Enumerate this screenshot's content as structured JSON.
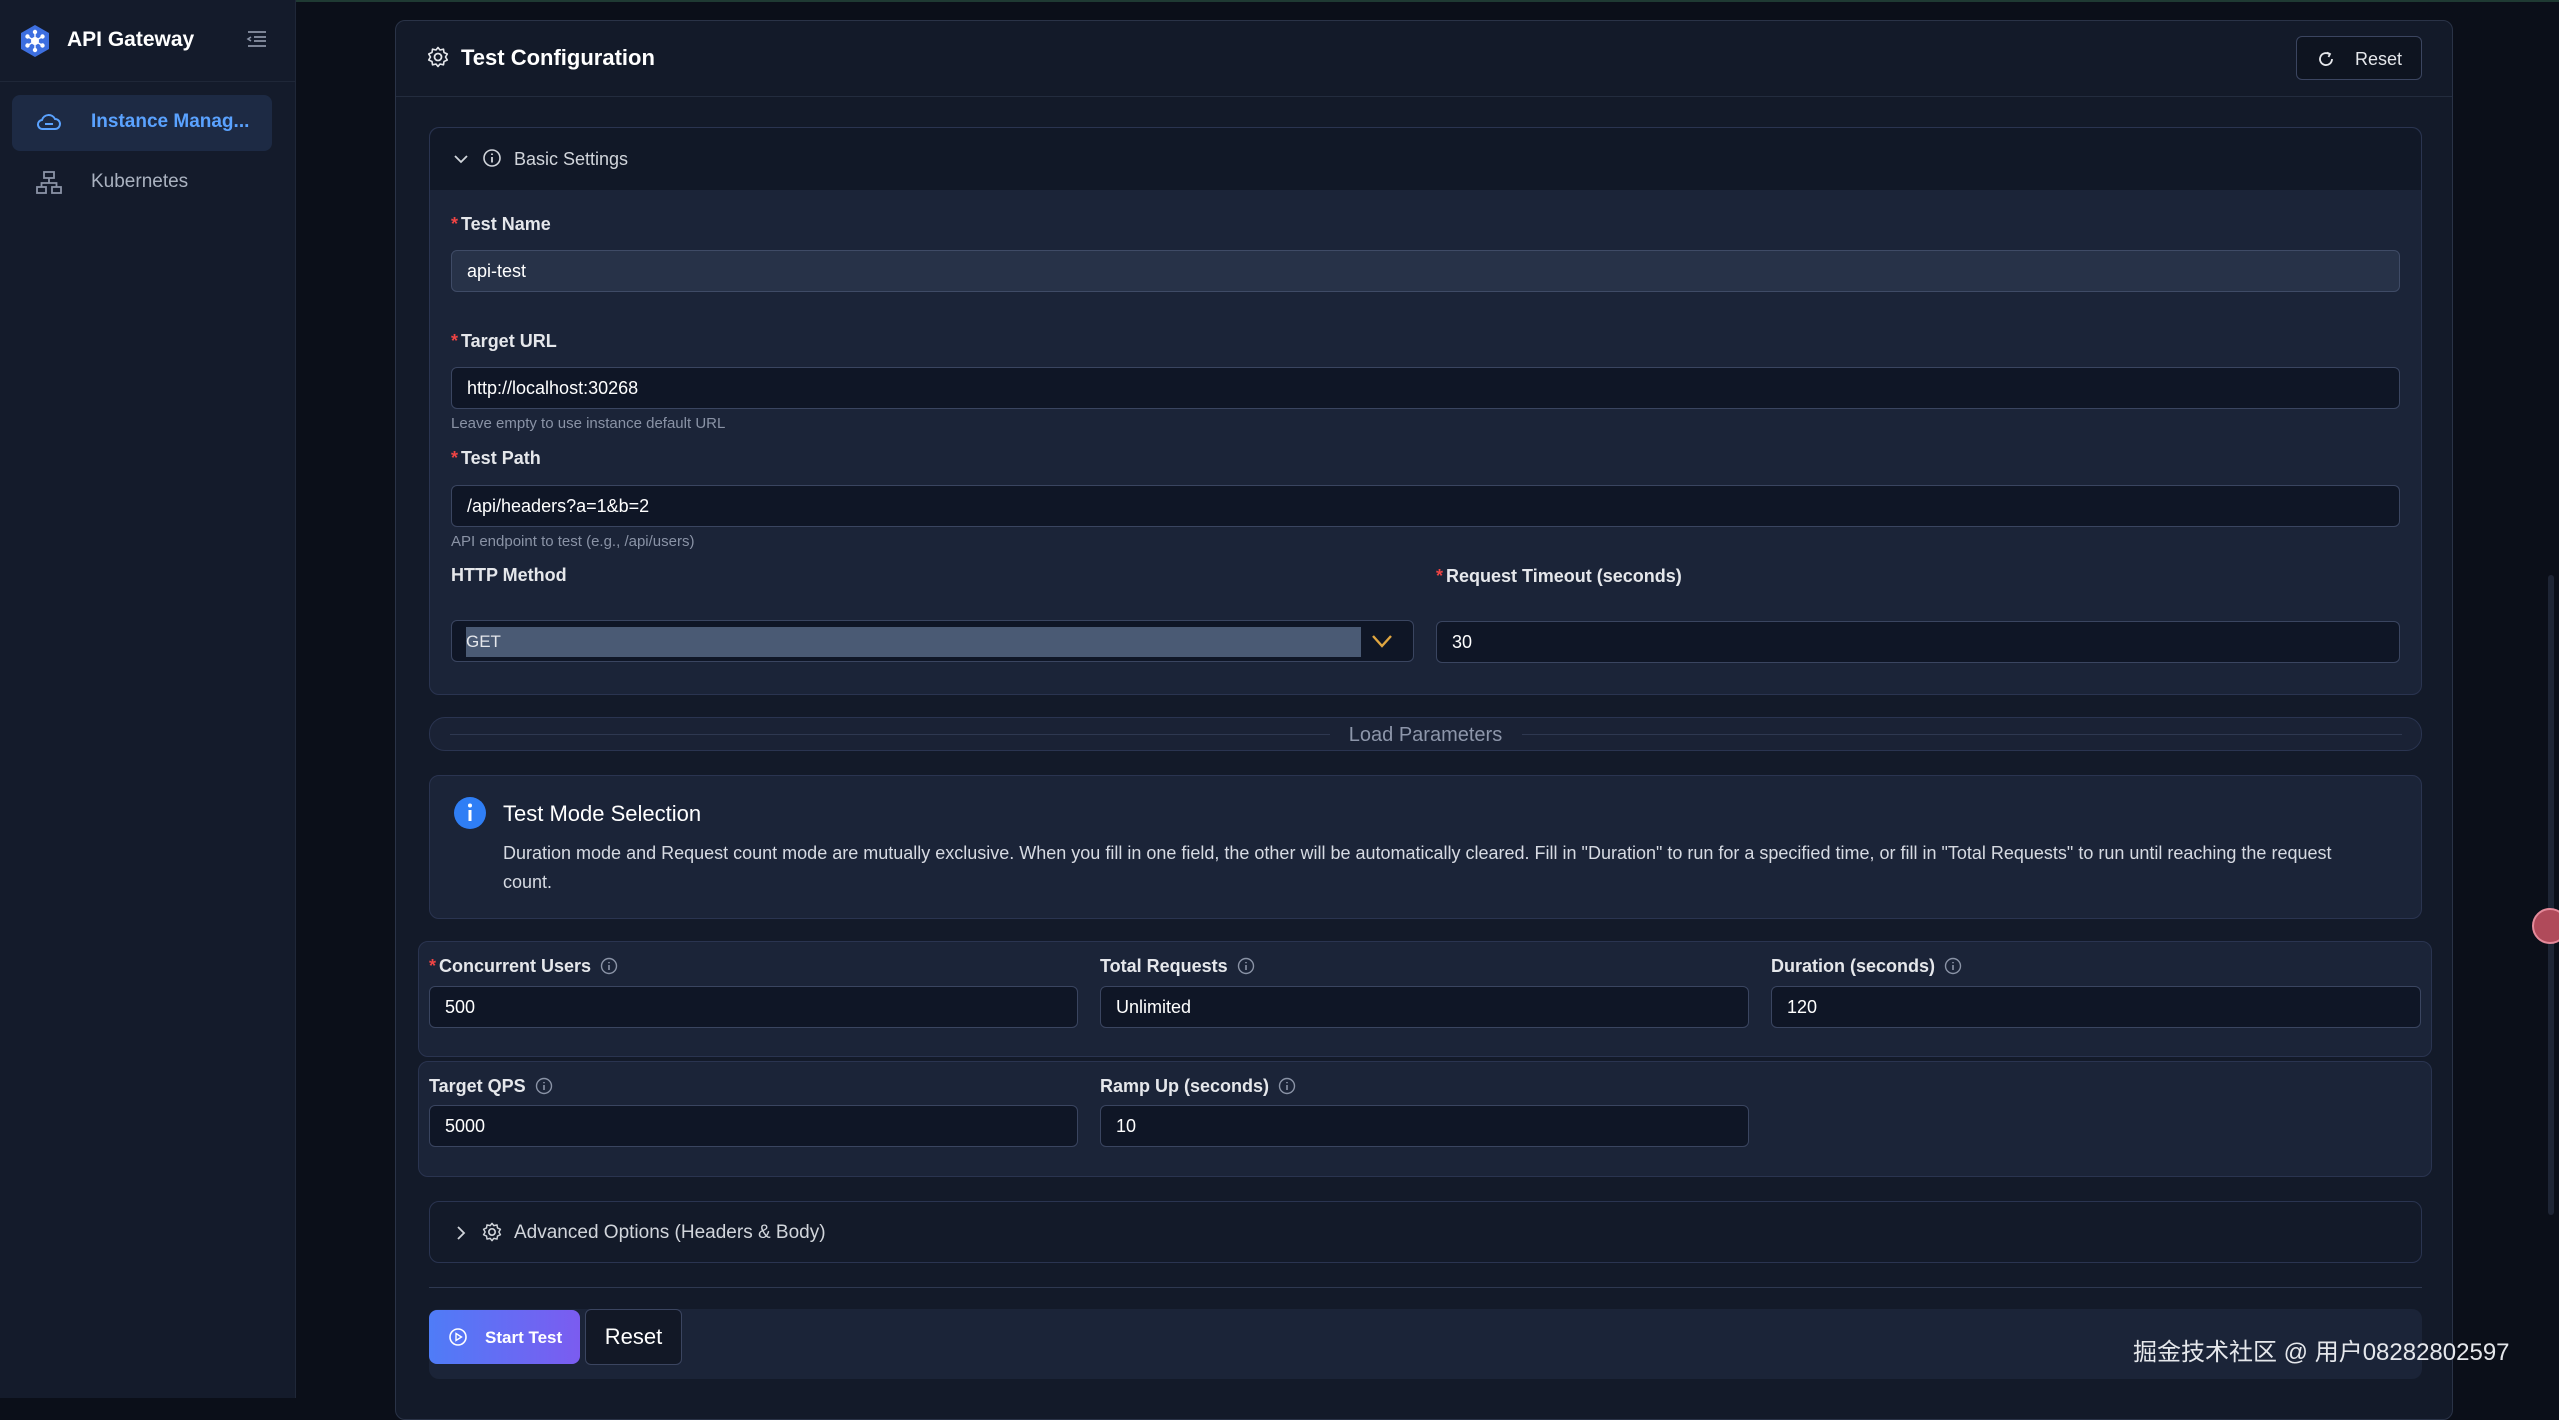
{
  "app": {
    "title": "API Gateway"
  },
  "sidebar": {
    "items": [
      {
        "label": "Instance Manag...",
        "icon": "cloud-icon",
        "active": true
      },
      {
        "label": "Kubernetes",
        "icon": "cluster-icon",
        "active": false
      }
    ]
  },
  "card": {
    "title": "Test Configuration",
    "reset_label": "Reset"
  },
  "basic": {
    "title": "Basic Settings",
    "test_name": {
      "label": "Test Name",
      "value": "api-test"
    },
    "target_url": {
      "label": "Target URL",
      "value": "http://localhost:30268",
      "help": "Leave empty to use instance default URL"
    },
    "test_path": {
      "label": "Test Path",
      "value": "/api/headers?a=1&b=2",
      "help": "API endpoint to test (e.g., /api/users)"
    },
    "http_method": {
      "label": "HTTP Method",
      "value": "GET"
    },
    "timeout": {
      "label": "Request Timeout (seconds)",
      "value": "30"
    }
  },
  "load": {
    "divider": "Load Parameters",
    "alert_title": "Test Mode Selection",
    "alert_body": "Duration mode and Request count mode are mutually exclusive. When you fill in one field, the other will be automatically cleared. Fill in \"Duration\" to run for a specified time, or fill in \"Total Requests\" to run until reaching the request count.",
    "concurrent": {
      "label": "Concurrent Users",
      "value": "500"
    },
    "total_requests": {
      "label": "Total Requests",
      "value": "Unlimited"
    },
    "duration": {
      "label": "Duration (seconds)",
      "value": "120"
    },
    "target_qps": {
      "label": "Target QPS",
      "value": "5000"
    },
    "ramp_up": {
      "label": "Ramp Up (seconds)",
      "value": "10"
    }
  },
  "advanced": {
    "title": "Advanced Options (Headers & Body)"
  },
  "actions": {
    "start_label": "Start Test",
    "reset_label": "Reset"
  },
  "watermark": "掘金技术社区 @ 用户08282802597",
  "colors": {
    "accent": "#5aa2ff",
    "required": "#ef4444",
    "gradient_start": "#4f7cf7",
    "gradient_end": "#7b5cf0",
    "select_chevron": "#e0a640"
  }
}
